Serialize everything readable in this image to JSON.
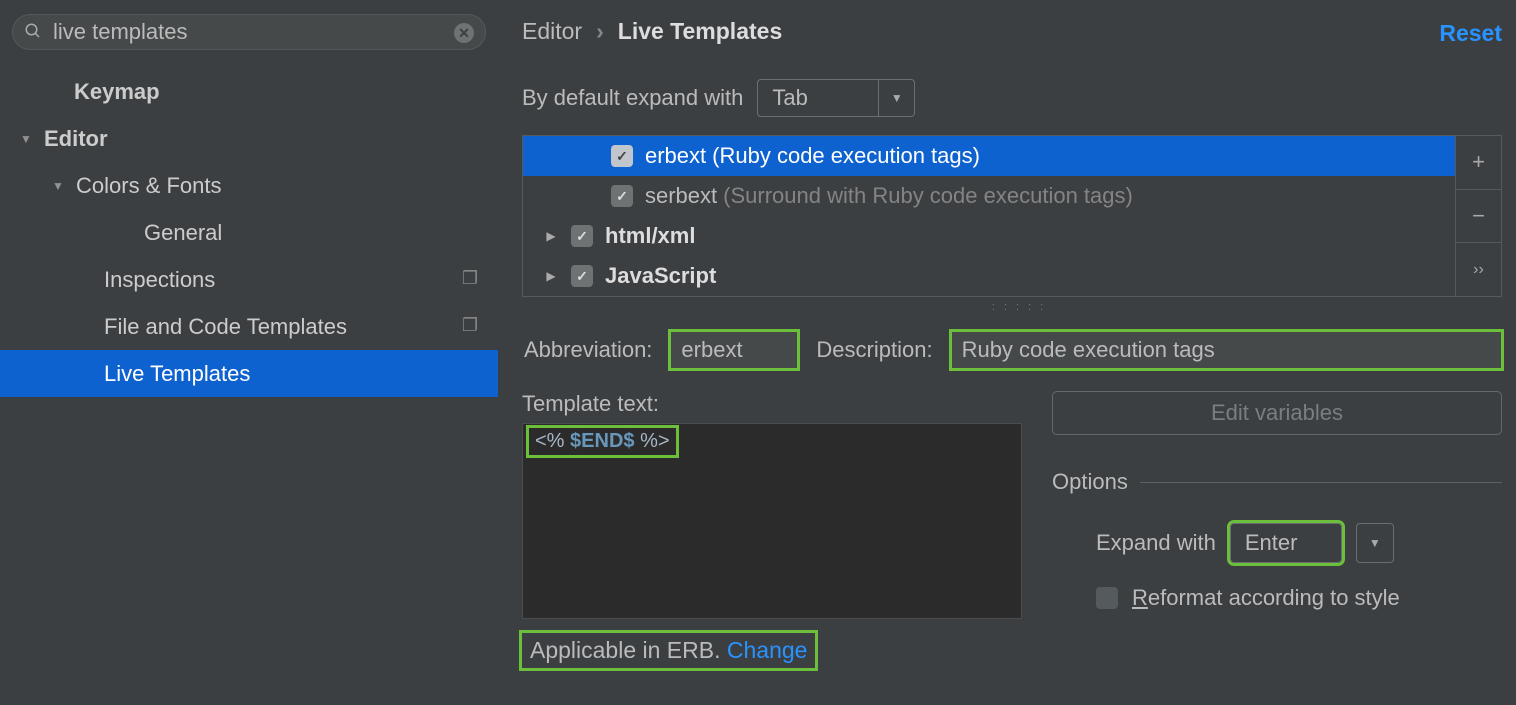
{
  "search": {
    "value": "live templates"
  },
  "tree": {
    "items": [
      {
        "label": "Keymap",
        "level": "lv1",
        "arrow": ""
      },
      {
        "label": "Editor",
        "level": "lv1",
        "arrow": "down",
        "bold": true
      },
      {
        "label": "Colors & Fonts",
        "level": "lv2",
        "arrow": "down"
      },
      {
        "label": "General",
        "level": "lv4",
        "arrow": ""
      },
      {
        "label": "Inspections",
        "level": "lv3",
        "arrow": "",
        "overlay": true
      },
      {
        "label": "File and Code Templates",
        "level": "lv3",
        "arrow": "",
        "overlay": true
      },
      {
        "label": "Live Templates",
        "level": "lv3",
        "arrow": "",
        "selected": true
      }
    ]
  },
  "breadcrumb": {
    "parent": "Editor",
    "current": "Live Templates"
  },
  "reset_label": "Reset",
  "default_expand": {
    "label": "By default expand with",
    "value": "Tab"
  },
  "list": {
    "items": [
      {
        "type": "item",
        "name": "erbext",
        "desc": "(Ruby code execution tags)",
        "selected": true
      },
      {
        "type": "item",
        "name": "serbext",
        "desc": "(Surround with Ruby code execution tags)"
      },
      {
        "type": "group",
        "name": "html/xml"
      },
      {
        "type": "group",
        "name": "JavaScript"
      }
    ]
  },
  "form": {
    "abbrev_label": "Abbreviation:",
    "abbrev_value": "erbext",
    "desc_label": "Description:",
    "desc_value": "Ruby code execution tags",
    "template_label": "Template text:",
    "template_prefix": "<%",
    "template_var": "$END$",
    "template_suffix": "%>",
    "edit_vars_label": "Edit variables",
    "options_label": "Options",
    "expand_label": "Expand with",
    "expand_value": "Enter",
    "reformat_label": "eformat according to style",
    "applicable_text": "Applicable in ERB.",
    "change_label": "Change"
  }
}
